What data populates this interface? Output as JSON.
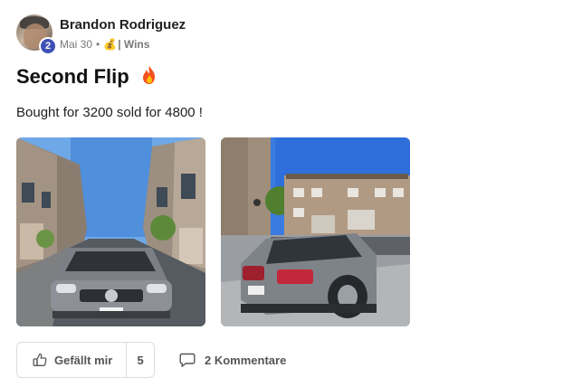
{
  "post": {
    "author": {
      "name": "Brandon Rodriguez",
      "level": "2"
    },
    "meta": {
      "date": "Mai 30",
      "separator": "•",
      "category_emoji": "💰",
      "category": "| Wins"
    },
    "title": "Second Flip",
    "body": "Bought for 3200 sold for 4800 !",
    "images": [
      {
        "alt": "Silver Mercedes sedan front view parked between townhouses",
        "name": "car-front-photo"
      },
      {
        "alt": "Silver Mercedes sedan rear view in townhouse parking lot",
        "name": "car-rear-photo"
      }
    ]
  },
  "actions": {
    "like_label": "Gefällt mir",
    "like_count": "5",
    "comments_label": "2 Kommentare"
  },
  "colors": {
    "badge": "#3f51b5",
    "fire": "#f4511e"
  }
}
